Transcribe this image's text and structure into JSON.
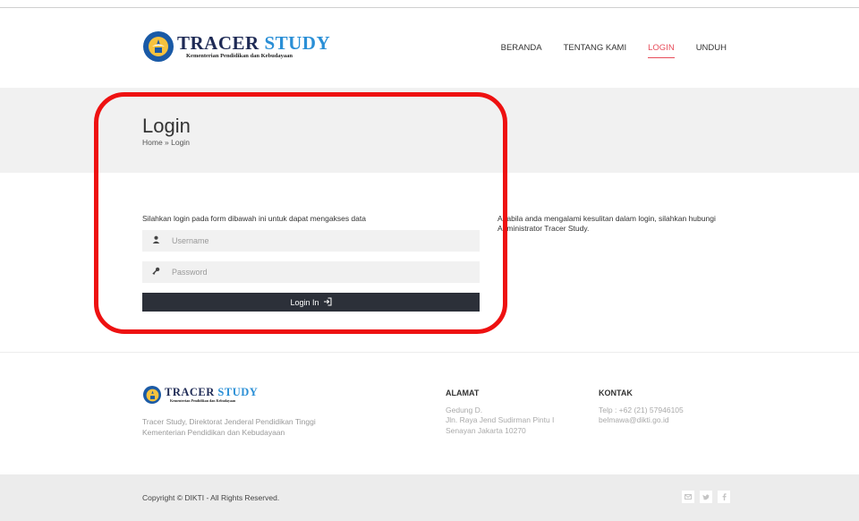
{
  "header": {
    "logo_title_part1": "TRACER",
    "logo_title_part2": "STUDY",
    "logo_subtitle": "Kementerian Pendidikan dan Kebudayaan",
    "nav": [
      "BERANDA",
      "TENTANG KAMI",
      "LOGIN",
      "UNDUH"
    ],
    "active_nav": "LOGIN"
  },
  "page": {
    "title": "Login",
    "breadcrumb": "Home » Login"
  },
  "login_form": {
    "intro": "Silahkan login pada form dibawah ini untuk dapat mengakses data",
    "username_placeholder": "Username",
    "password_placeholder": "Password",
    "submit_label": "Login In"
  },
  "help_text": "Apabila anda mengalami kesulitan dalam login, silahkan hubungi Administrator Tracer Study.",
  "footer": {
    "desc_line1": "Tracer Study, Direktorat Jenderal Pendidikan Tinggi",
    "desc_line2": "Kementerian Pendidikan dan Kebudayaan",
    "alamat_heading": "ALAMAT",
    "alamat_lines": [
      "Gedung D.",
      "Jln. Raya Jend Sudirman Pintu I",
      "Senayan Jakarta 10270"
    ],
    "kontak_heading": "KONTAK",
    "kontak_lines": [
      "Telp : +62 (21) 57946105",
      "belmawa@dikti.go.id"
    ],
    "copyright": "Copyright © DIKTI - All Rights Reserved.",
    "socials": [
      "email-icon",
      "twitter-icon",
      "facebook-icon"
    ]
  },
  "colors": {
    "accent": "#e74c5a",
    "highlight": "#ee1111",
    "button_bg": "#2c3039"
  }
}
